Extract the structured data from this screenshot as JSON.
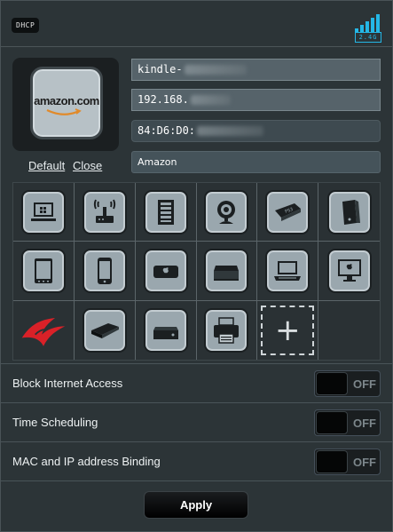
{
  "header": {
    "badge": "DHCP",
    "band": "2.4G",
    "accent": "#24b7e6"
  },
  "device": {
    "image_brand_text": "amazon.com",
    "links": {
      "default": "Default",
      "close": "Close"
    },
    "hostname": "kindle-",
    "ip": "192.168.",
    "mac": "84:D6:D0:",
    "name": "Amazon"
  },
  "icons": [
    "windows-laptop-icon",
    "router-icon",
    "nas-server-icon",
    "webcam-icon",
    "ps3-console-icon",
    "xbox-console-icon",
    "android-tablet-icon",
    "android-phone-icon",
    "apple-tv-icon",
    "media-box-icon",
    "macbook-icon",
    "imac-icon",
    "rog-logo-icon",
    "ps4-console-icon",
    "xbox-one-icon",
    "printer-icon",
    "add-icon"
  ],
  "add_label": "+",
  "settings": [
    {
      "label": "Block Internet Access",
      "state": "OFF"
    },
    {
      "label": "Time Scheduling",
      "state": "OFF"
    },
    {
      "label": "MAC and IP address Binding",
      "state": "OFF"
    }
  ],
  "apply_label": "Apply"
}
